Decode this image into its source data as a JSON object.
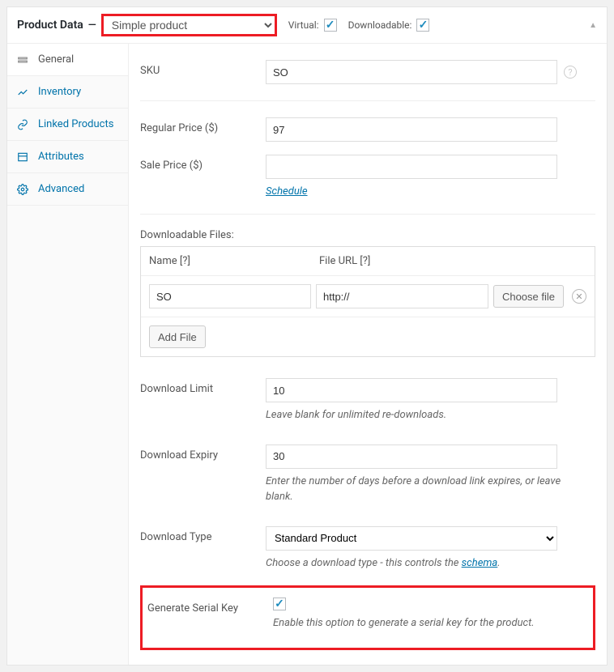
{
  "header": {
    "title": "Product Data",
    "product_type": "Simple product",
    "virtual_label": "Virtual:",
    "virtual_checked": true,
    "downloadable_label": "Downloadable:",
    "downloadable_checked": true
  },
  "sidebar": {
    "items": [
      {
        "label": "General",
        "icon": "wrench-icon",
        "active": true
      },
      {
        "label": "Inventory",
        "icon": "chart-icon",
        "active": false
      },
      {
        "label": "Linked Products",
        "icon": "link-icon",
        "active": false
      },
      {
        "label": "Attributes",
        "icon": "list-icon",
        "active": false
      },
      {
        "label": "Advanced",
        "icon": "gear-icon",
        "active": false
      }
    ]
  },
  "form": {
    "sku_label": "SKU",
    "sku_value": "SO",
    "regular_price_label": "Regular Price ($)",
    "regular_price_value": "97",
    "sale_price_label": "Sale Price ($)",
    "sale_price_value": "",
    "schedule_link": "Schedule",
    "downloadable_files_label": "Downloadable Files:",
    "files": {
      "name_header": "Name [?]",
      "url_header": "File URL [?]",
      "rows": [
        {
          "name": "SO",
          "url": "http://"
        }
      ],
      "choose_file_btn": "Choose file",
      "add_file_btn": "Add File"
    },
    "download_limit_label": "Download Limit",
    "download_limit_value": "10",
    "download_limit_desc": "Leave blank for unlimited re-downloads.",
    "download_expiry_label": "Download Expiry",
    "download_expiry_value": "30",
    "download_expiry_desc": "Enter the number of days before a download link expires, or leave blank.",
    "download_type_label": "Download Type",
    "download_type_value": "Standard Product",
    "download_type_desc_pre": "Choose a download type - this controls the ",
    "download_type_desc_link": "schema",
    "download_type_desc_post": ".",
    "generate_serial_label": "Generate Serial Key",
    "generate_serial_checked": true,
    "generate_serial_desc": "Enable this option to generate a serial key for the product."
  }
}
